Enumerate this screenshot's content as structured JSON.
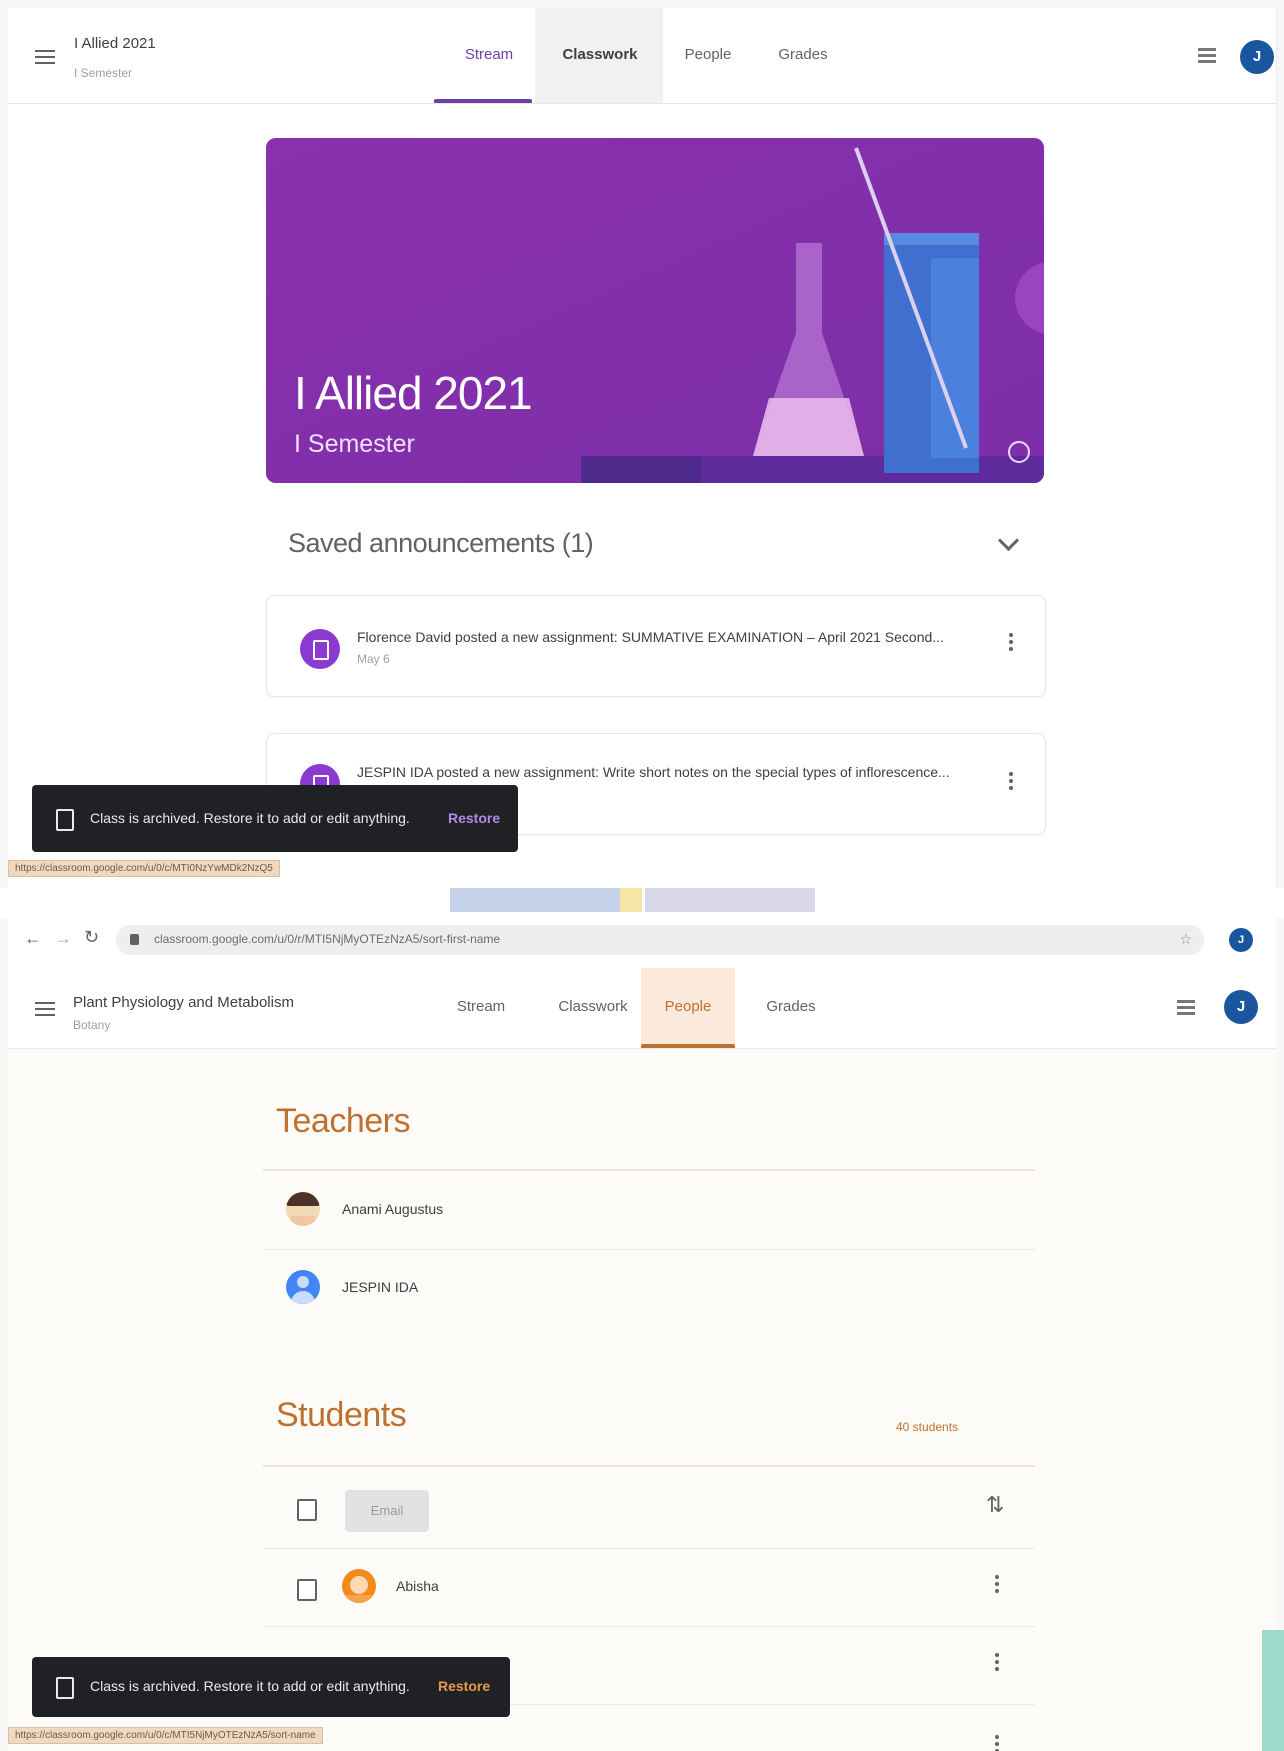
{
  "panel1": {
    "class_title": "I Allied 2021",
    "class_subtitle": "I Semester",
    "tabs": [
      {
        "label": "Stream"
      },
      {
        "label": "Classwork"
      },
      {
        "label": "People"
      },
      {
        "label": "Grades"
      }
    ],
    "active_tab": "Stream",
    "account_initial": "J",
    "banner": {
      "title": "I Allied 2021",
      "subtitle": "I Semester",
      "color": "#8a34b0"
    },
    "saved_announcements_label": "Saved announcements (1)",
    "posts": [
      {
        "text": "Florence David posted a new assignment: SUMMATIVE EXAMINATION – April 2021 Second...",
        "date": "May 6"
      },
      {
        "text": "JESPIN IDA posted a new assignment: Write short notes on the special types of inflorescence..."
      }
    ],
    "snackbar": {
      "message": "Class is archived. Restore it to add or edit anything.",
      "action": "Restore"
    },
    "status_url": "https://classroom.google.com/u/0/c/MTI0NzYwMDk2NzQ5"
  },
  "panel2": {
    "browser": {
      "url": "classroom.google.com/u/0/r/MTI5NjMyOTEzNzA5/sort-first-name"
    },
    "class_title": "Plant Physiology and Metabolism",
    "class_subtitle": "Botany",
    "tabs": [
      {
        "label": "Stream"
      },
      {
        "label": "Classwork"
      },
      {
        "label": "People"
      },
      {
        "label": "Grades"
      }
    ],
    "active_tab": "People",
    "account_initial": "J",
    "teachers_heading": "Teachers",
    "teachers": [
      {
        "name": "Anami Augustus"
      },
      {
        "name": "JESPIN IDA"
      }
    ],
    "students_heading": "Students",
    "students_count": "40 students",
    "email_button": "Email",
    "students": [
      {
        "name": "Abisha"
      }
    ],
    "snackbar": {
      "message": "Class is archived. Restore it to add or edit anything.",
      "action": "Restore"
    },
    "status_url": "https://classroom.google.com/u/0/c/MTI5NjMyOTEzNzA5/sort-name"
  },
  "colors": {
    "accent_purple": "#6f3fa8",
    "accent_orange": "#c0702e",
    "banner_purple": "#8a34b0"
  }
}
